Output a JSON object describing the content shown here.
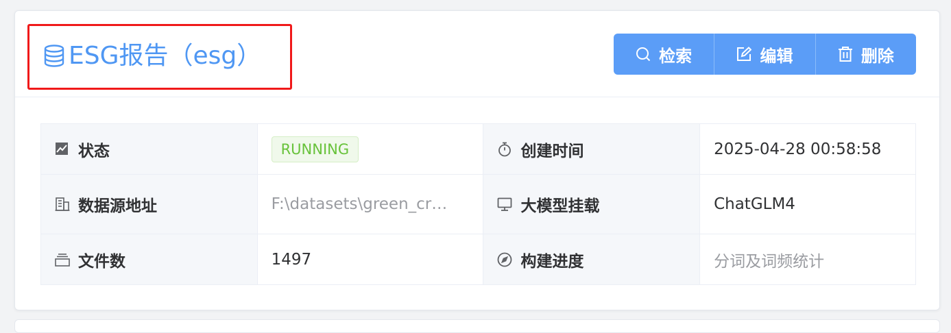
{
  "header": {
    "title": "ESG报告（esg）",
    "title_icon": "database-icon",
    "buttons": [
      {
        "label": "检索",
        "icon": "search-icon"
      },
      {
        "label": "编辑",
        "icon": "edit-icon"
      },
      {
        "label": "删除",
        "icon": "trash-icon"
      }
    ]
  },
  "details": {
    "status_label": "状态",
    "status_value": "RUNNING",
    "created_label": "创建时间",
    "created_value": "2025-04-28 00:58:58",
    "source_label": "数据源地址",
    "source_value": "F:\\datasets\\green_cr…",
    "model_label": "大模型挂载",
    "model_value": "ChatGLM4",
    "files_label": "文件数",
    "files_value": "1497",
    "progress_label": "构建进度",
    "progress_value": "分词及词频统计"
  },
  "colors": {
    "accent": "#4f97f3",
    "button_bg": "#5b9df7",
    "highlight": "#f0191a",
    "status_green": "#67c23a"
  }
}
